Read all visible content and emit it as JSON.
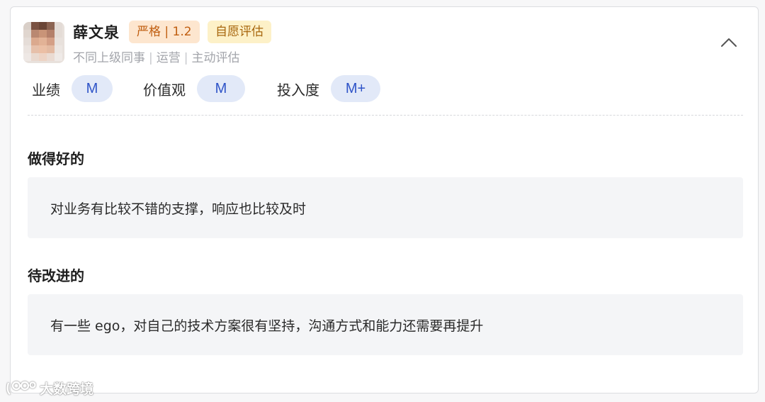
{
  "reviewer": {
    "name": "薛文泉",
    "tags": {
      "strict": "严格 | 1.2",
      "self_eval": "自愿评估"
    },
    "meta": [
      "不同上级同事",
      "运营",
      "主动评估"
    ]
  },
  "scores": [
    {
      "label": "业绩",
      "value": "M"
    },
    {
      "label": "价值观",
      "value": "M"
    },
    {
      "label": "投入度",
      "value": "M+"
    }
  ],
  "sections": {
    "good": {
      "title": "做得好的",
      "content": "对业务有比较不错的支撑，响应也比较及时"
    },
    "improve": {
      "title": "待改进的",
      "content": "有一些 ego，对自己的技术方案很有坚持，沟通方式和能力还需要再提升"
    }
  },
  "icons": {
    "collapse": "chevron-up-icon",
    "watermark_logo": "logo-icon"
  },
  "watermark": {
    "text": "大数跨境"
  },
  "colors": {
    "score_pill_bg": "#e2e9f8",
    "score_pill_text": "#2f54c8",
    "tag_strict_bg": "#fde6cf",
    "tag_strict_text": "#c05e10",
    "tag_self_bg": "#fdf1c8",
    "tag_self_text": "#a8670e"
  }
}
